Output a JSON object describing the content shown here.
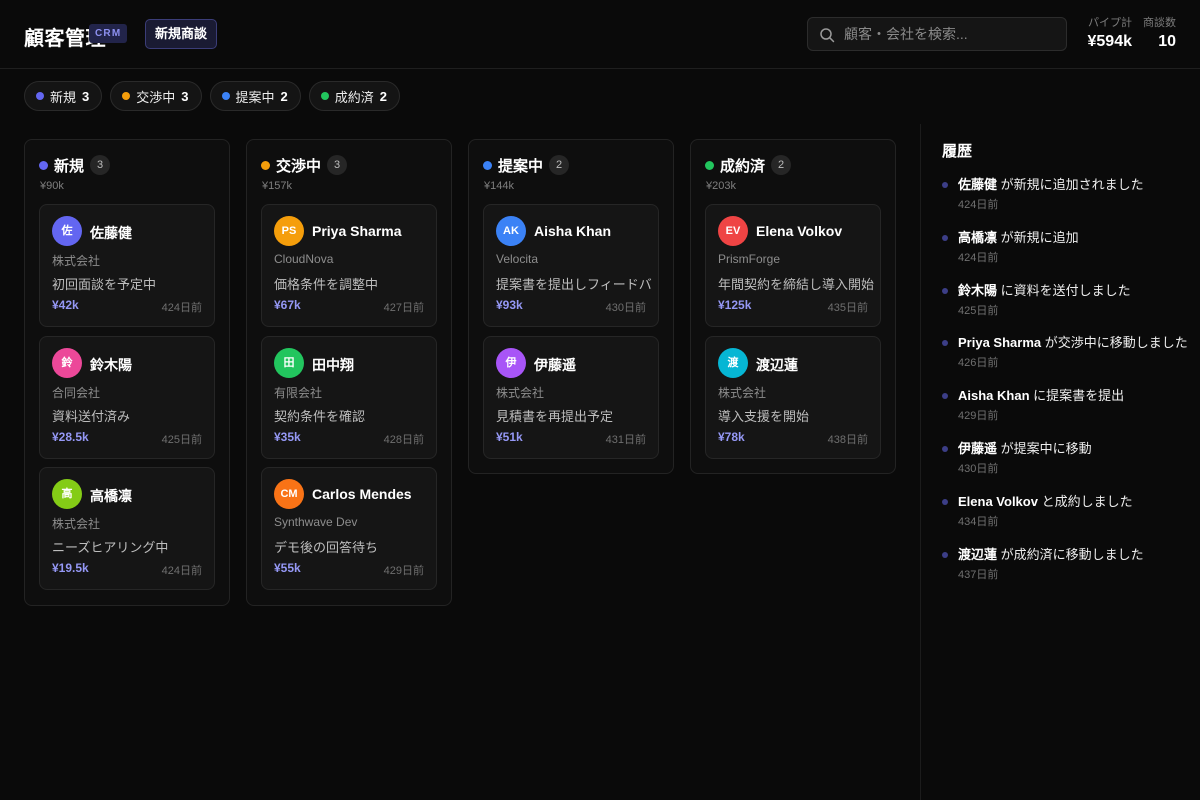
{
  "header": {
    "title": "顧客管理",
    "badge": "CRM",
    "button_label": "新規商談",
    "search_placeholder": "顧客・会社を検索...",
    "stats": [
      {
        "label": "パイプ計",
        "value": "¥594k"
      },
      {
        "label": "商談数",
        "value": "10"
      }
    ]
  },
  "icons": {
    "search": "search-icon"
  },
  "filters": [
    {
      "label": "新規",
      "count": "3",
      "color": "#6366f1"
    },
    {
      "label": "交渉中",
      "count": "3",
      "color": "#f59e0b"
    },
    {
      "label": "提案中",
      "count": "2",
      "color": "#3b82f6"
    },
    {
      "label": "成約済",
      "count": "2",
      "color": "#22c55e"
    }
  ],
  "columns": [
    {
      "title": "新規",
      "count": "3",
      "total": "¥90k",
      "color": "#6366f1",
      "cards": [
        {
          "initials": "佐",
          "name": "佐藤健",
          "company": "株式会社",
          "note": "初回面談を予定中",
          "value": "¥42k",
          "date": "424日前",
          "avatar_color": "#6366f1"
        },
        {
          "initials": "鈴",
          "name": "鈴木陽",
          "company": "合同会社",
          "note": "資料送付済み",
          "value": "¥28.5k",
          "date": "425日前",
          "avatar_color": "#ec4899"
        },
        {
          "initials": "高",
          "name": "高橋凛",
          "company": "株式会社",
          "note": "ニーズヒアリング中",
          "value": "¥19.5k",
          "date": "424日前",
          "avatar_color": "#84cc16"
        }
      ]
    },
    {
      "title": "交渉中",
      "count": "3",
      "total": "¥157k",
      "color": "#f59e0b",
      "cards": [
        {
          "initials": "PS",
          "name": "Priya Sharma",
          "company": "CloudNova",
          "note": "価格条件を調整中",
          "value": "¥67k",
          "date": "427日前",
          "avatar_color": "#f59e0b"
        },
        {
          "initials": "田",
          "name": "田中翔",
          "company": "有限会社",
          "note": "契約条件を確認",
          "value": "¥35k",
          "date": "428日前",
          "avatar_color": "#22c55e"
        },
        {
          "initials": "CM",
          "name": "Carlos Mendes",
          "company": "Synthwave Dev",
          "note": "デモ後の回答待ち",
          "value": "¥55k",
          "date": "429日前",
          "avatar_color": "#f97316"
        }
      ]
    },
    {
      "title": "提案中",
      "count": "2",
      "total": "¥144k",
      "color": "#3b82f6",
      "cards": [
        {
          "initials": "AK",
          "name": "Aisha Khan",
          "company": "Velocita",
          "note": "提案書を提出しフィードバック待ち",
          "value": "¥93k",
          "date": "430日前",
          "avatar_color": "#3b82f6"
        },
        {
          "initials": "伊",
          "name": "伊藤遥",
          "company": "株式会社",
          "note": "見積書を再提出予定",
          "value": "¥51k",
          "date": "431日前",
          "avatar_color": "#a855f7"
        }
      ]
    },
    {
      "title": "成約済",
      "count": "2",
      "total": "¥203k",
      "color": "#22c55e",
      "cards": [
        {
          "initials": "EV",
          "name": "Elena Volkov",
          "company": "PrismForge",
          "note": "年間契約を締結し導入開始",
          "value": "¥125k",
          "date": "435日前",
          "avatar_color": "#ef4444"
        },
        {
          "initials": "渡",
          "name": "渡辺蓮",
          "company": "株式会社",
          "note": "導入支援を開始",
          "value": "¥78k",
          "date": "438日前",
          "avatar_color": "#06b6d4"
        }
      ]
    }
  ],
  "activity": {
    "title": "履歴",
    "items": [
      {
        "name": "佐藤健",
        "action": "が新規に追加されました",
        "date": "424日前"
      },
      {
        "name": "高橋凛",
        "action": "が新規に追加",
        "date": "424日前"
      },
      {
        "name": "鈴木陽",
        "action": "に資料を送付しました",
        "date": "425日前"
      },
      {
        "name": "Priya Sharma",
        "action": "が交渉中に移動しました",
        "date": "426日前"
      },
      {
        "name": "Aisha Khan",
        "action": "に提案書を提出",
        "date": "429日前"
      },
      {
        "name": "伊藤遥",
        "action": "が提案中に移動",
        "date": "430日前"
      },
      {
        "name": "Elena Volkov",
        "action": "と成約しました",
        "date": "434日前"
      },
      {
        "name": "渡辺蓮",
        "action": "が成約済に移動しました",
        "date": "437日前"
      }
    ]
  }
}
